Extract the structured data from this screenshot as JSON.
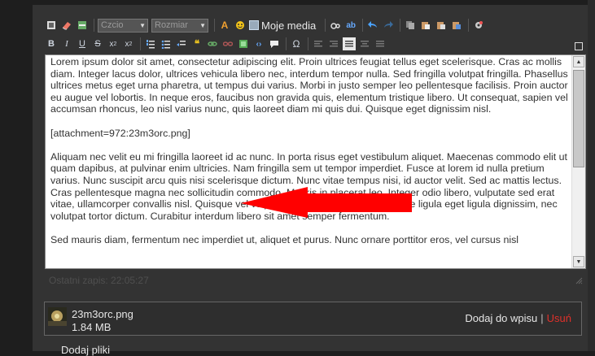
{
  "toolbar": {
    "font_select": "Czcio",
    "size_select": "Rozmiar",
    "media_label": "Moje media"
  },
  "editor": {
    "paragraphs": [
      "Lorem ipsum dolor sit amet, consectetur adipiscing elit. Proin ultrices feugiat tellus eget scelerisque. Cras ac mollis diam. Integer lacus dolor, ultrices vehicula libero nec, interdum tempor nulla. Sed fringilla volutpat fringilla. Phasellus ultrices metus eget urna pharetra, ut tempus dui varius. Morbi in justo semper leo pellentesque facilisis. Proin auctor eu augue vel lobortis. In neque eros, faucibus non gravida quis, elementum tristique libero. Ut consequat, sapien vel accumsan rhoncus, leo nisl varius nunc, quis laoreet diam mi quis dui. Quisque eget dignissim nisl.",
      "[attachment=972:23m3orc.png]",
      "Aliquam nec velit eu mi fringilla laoreet id ac nunc. In porta risus eget vestibulum aliquet. Maecenas commodo elit ut quam dapibus, at pulvinar enim ultricies. Nam fringilla sem ut tempor imperdiet. Fusce at lorem id nulla pretium varius. Nunc suscipit arcu quis nisi scelerisque dictum. Nunc vitae tempus nisi, id auctor velit. Sed ac mattis lectus. Cras pellentesque magna nec sollicitudin commodo. Mauris in placerat leo. Integer odio libero, vulputate sed erat vitae, ullamcorper convallis nisl. Quisque vel vulputate odio. Aliquam pellentesque ligula eget ligula dignissim, nec volutpat tortor dictum. Curabitur interdum libero sit amet semper fermentum.",
      "Sed mauris diam, fermentum nec imperdiet ut, aliquet et purus. Nunc ornare porttitor eros, vel cursus nisl"
    ]
  },
  "status": {
    "last_saved": "Ostatni zapis: 22:05:27"
  },
  "attachment": {
    "filename": "23m3orc.png",
    "size": "1.84 MB",
    "add_label": "Dodaj do wpisu",
    "separator": "|",
    "delete_label": "Usuń"
  },
  "footer": {
    "add_files": "Dodaj pliki"
  },
  "colors": {
    "background": "#1e1e1e",
    "panel": "#333333",
    "arrow": "#ff0000",
    "delete": "#e0302a"
  }
}
